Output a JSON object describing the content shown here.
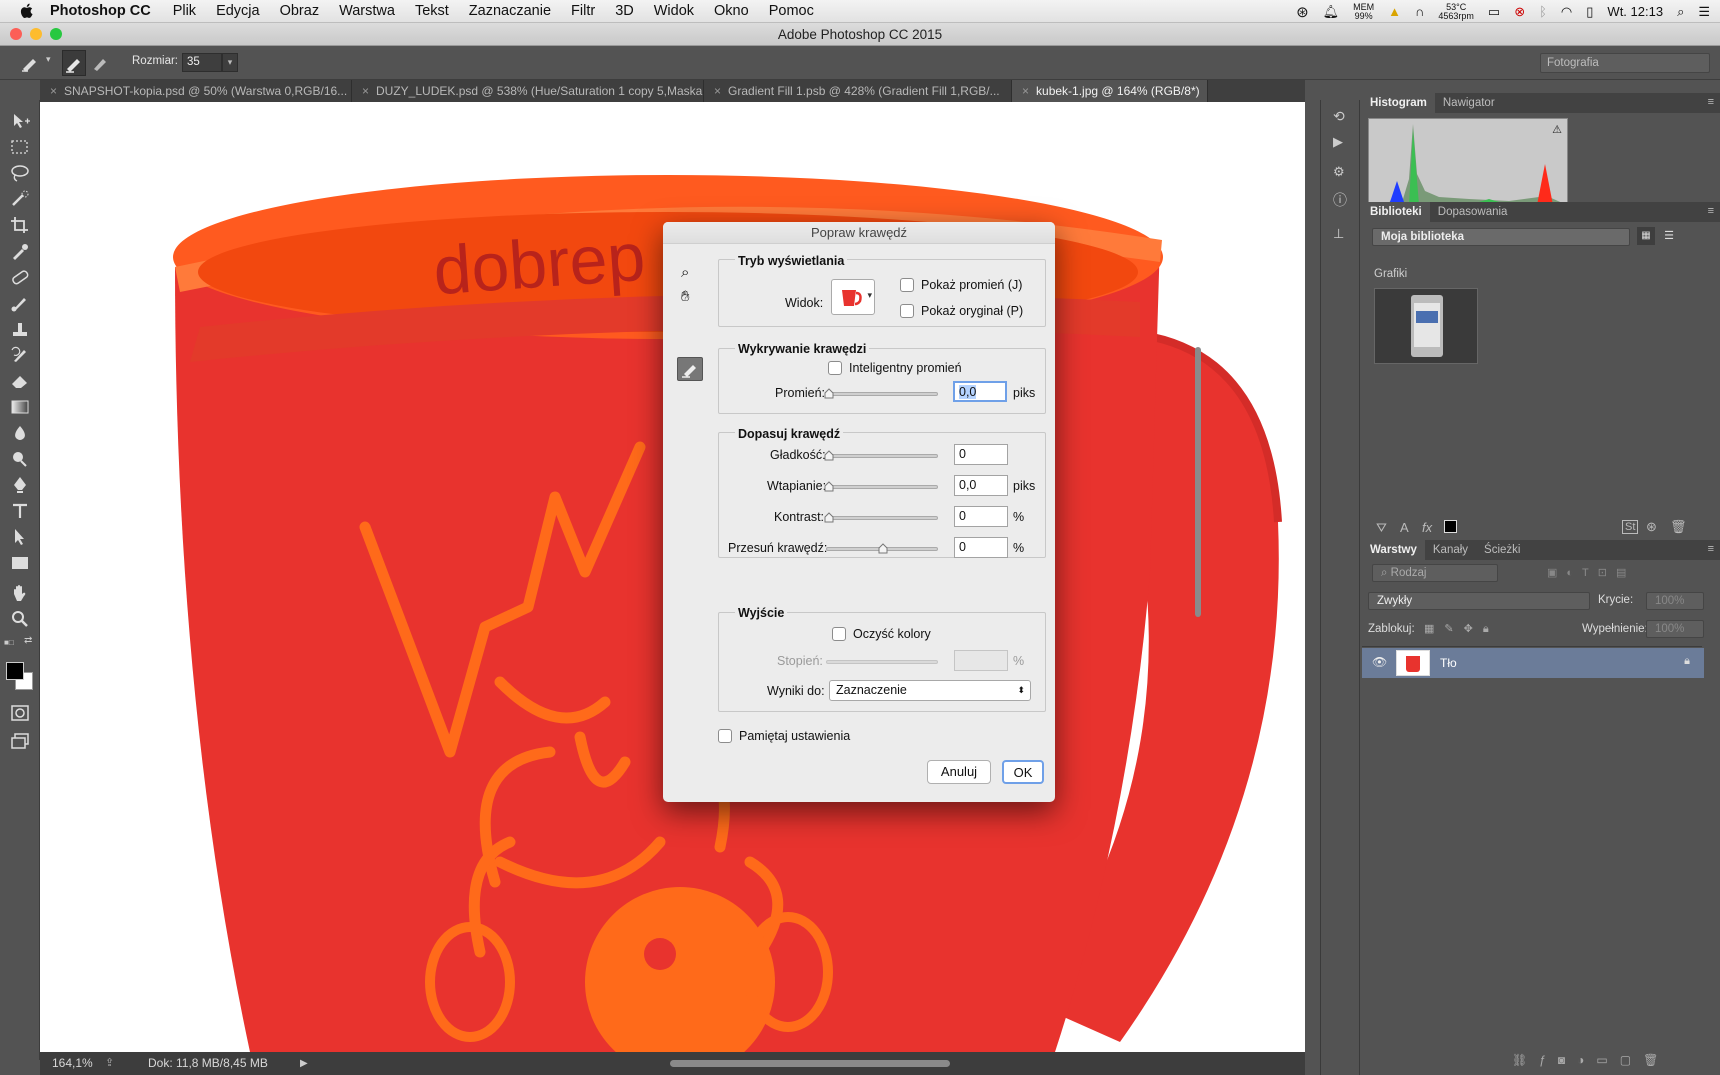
{
  "menubar": {
    "app_name": "Photoshop CC",
    "items": [
      "Plik",
      "Edycja",
      "Obraz",
      "Warstwa",
      "Tekst",
      "Zaznaczanie",
      "Filtr",
      "3D",
      "Widok",
      "Okno",
      "Pomoc"
    ],
    "mem_label": "MEM",
    "mem_value": "99%",
    "temp": "53°C",
    "rpm": "4563rpm",
    "clock": "Wt. 12:13"
  },
  "window": {
    "title": "Adobe Photoshop CC 2015"
  },
  "options_bar": {
    "size_label": "Rozmiar:",
    "size_value": "35",
    "workspace": "Fotografia"
  },
  "tabs": [
    {
      "label": "SNAPSHOT-kopia.psd @ 50% (Warstwa 0,RGB/16..."
    },
    {
      "label": "DUZY_LUDEK.psd @ 538% (Hue/Saturation 1 copy 5,Maska ..."
    },
    {
      "label": "Gradient Fill 1.psb @ 428% (Gradient Fill 1,RGB/..."
    },
    {
      "label": "kubek-1.jpg @ 164% (RGB/8*)"
    }
  ],
  "canvas": {
    "mug_text": "dobrep"
  },
  "status_bar": {
    "zoom": "164,1%",
    "doc": "Dok: 11,8 MB/8,45 MB"
  },
  "panels": {
    "histogram_tabs": [
      "Histogram",
      "Nawigator"
    ],
    "library_tabs": [
      "Biblioteki",
      "Dopasowania"
    ],
    "library_name": "Moja biblioteka",
    "graphics_label": "Grafiki",
    "layers_tabs": [
      "Warstwy",
      "Kanały",
      "Ścieżki"
    ],
    "filter_kind": "Rodzaj",
    "blend_mode": "Zwykły",
    "opacity_label": "Krycie:",
    "opacity_value": "100%",
    "lock_label": "Zablokuj:",
    "fill_label": "Wypełnienie:",
    "fill_value": "100%",
    "layer_name": "Tło"
  },
  "dialog": {
    "title": "Popraw krawędź",
    "view_mode": {
      "title": "Tryb wyświetlania",
      "view_label": "Widok:",
      "show_radius": "Pokaż promień (J)",
      "show_original": "Pokaż oryginał (P)"
    },
    "edge_detection": {
      "title": "Wykrywanie krawędzi",
      "smart_radius": "Inteligentny promień",
      "radius_label": "Promień:",
      "radius_value": "0,0",
      "radius_unit": "piks"
    },
    "adjust_edge": {
      "title": "Dopasuj krawędź",
      "smooth_label": "Gładkość:",
      "smooth_value": "0",
      "feather_label": "Wtapianie:",
      "feather_value": "0,0",
      "feather_unit": "piks",
      "contrast_label": "Kontrast:",
      "contrast_value": "0",
      "contrast_unit": "%",
      "shift_label": "Przesuń krawędź:",
      "shift_value": "0",
      "shift_unit": "%"
    },
    "output": {
      "title": "Wyjście",
      "decontaminate": "Oczyść kolory",
      "amount_label": "Stopień:",
      "amount_unit": "%",
      "output_to_label": "Wyniki do:",
      "output_to_value": "Zaznaczenie"
    },
    "remember": "Pamiętaj ustawienia",
    "cancel": "Anuluj",
    "ok": "OK"
  },
  "colors": {
    "mug_red": "#e8332e",
    "mug_inner": "#ff5a1f",
    "accent_orange": "#ff6a1a",
    "panel_bg": "#535353",
    "layer_selected": "#6b7c99"
  }
}
